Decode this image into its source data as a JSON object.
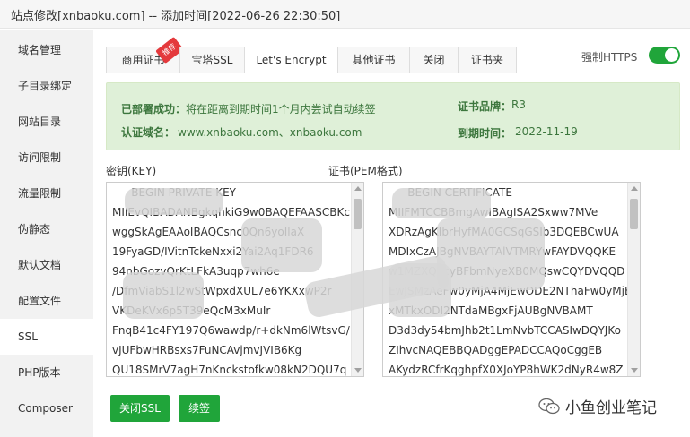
{
  "window": {
    "title": "站点修改[xnbaoku.com] -- 添加时间[2022-06-26 22:30:50]"
  },
  "sidebar": {
    "items": [
      {
        "label": "域名管理"
      },
      {
        "label": "子目录绑定"
      },
      {
        "label": "网站目录"
      },
      {
        "label": "访问限制"
      },
      {
        "label": "流量限制"
      },
      {
        "label": "伪静态"
      },
      {
        "label": "默认文档"
      },
      {
        "label": "配置文件"
      },
      {
        "label": "SSL",
        "active": true
      },
      {
        "label": "PHP版本"
      },
      {
        "label": "Composer"
      }
    ]
  },
  "tabs": {
    "items": [
      {
        "label": "商用证书",
        "badge": "推荐"
      },
      {
        "label": "宝塔SSL"
      },
      {
        "label": "Let's Encrypt",
        "active": true
      },
      {
        "label": "其他证书"
      },
      {
        "label": "关闭"
      },
      {
        "label": "证书夹"
      }
    ]
  },
  "https": {
    "label": "强制HTTPS",
    "enabled": true
  },
  "info": {
    "deployed_label": "已部署成功：",
    "deployed_value": "将在距离到期时间1个月内尝试自动续签",
    "domain_label": "认证域名：",
    "domain_value": "www.xnbaoku.com、xnbaoku.com",
    "brand_label": "证书品牌：",
    "brand_value": "R3",
    "expire_label": "到期时间：",
    "expire_value": "2022-11-19"
  },
  "key": {
    "label": "密钥(KEY)",
    "lines": [
      "-----BEGIN PRIVATE KEY-----",
      "MIIEvQIBADANBgkqhkiG9w0BAQEFAASCBKc",
      "wggSkAgEAAoIBAQCsnc0Qn6yoIlaX",
      "19FyaGD/IVitnTckeNxxi2Yai2Aq1FDR6",
      "94nbGozvQrKtLFkA3uqp7wh6e",
      "/DfmViabS1l2wStWpxdXUL7e6YKXxwP2r",
      "VKDeKVx6p5T39eQcM3xMuIr",
      "FnqB41c4FY197Q6wawdp/r+dkNm6lWtsvG/",
      "vJUFbwHRBsxs7FuNCAvjmvJVIB6Kg",
      "QU18SMrV7agH7nKnckstofkw08kN2DQU7q"
    ]
  },
  "cert": {
    "label": "证书(PEM格式)",
    "lines": [
      "-----BEGIN CERTIFICATE-----",
      "MIIFMTCCBBmgAwIBAgISA2Sxww7MVe",
      "XDRzAgKIbrHyfMA0GCSqGSIb3DQEBCwUA",
      "MDIxCzAJBgNVBAYTAlVTMRYwFAYDVQQKE",
      "w1MZXQncyBFbmNyeXB0MQswCQYDVQQD",
      "EwJSMzAeFw0yMjA4MjEwODE2NThaFw0yMjE",
      "xMTkxODI2NTdaMBgxFjAUBgNVBAMT",
      "D3d3dy54bmJhb2t1LmNvbTCCASIwDQYJKo",
      "ZIhvcNAQEBBQADggEPADCCAQoCggEB",
      "AKydzRCfrKqghpfX0XJoYP8hWK2dNyR4w8Z"
    ]
  },
  "buttons": {
    "close_ssl": "关闭SSL",
    "renew": "续签"
  },
  "watermark": {
    "text": "小鱼创业笔记"
  },
  "colors": {
    "accent": "#20a53a",
    "badge": "#e4393c",
    "success_bg": "#dff0d8"
  }
}
